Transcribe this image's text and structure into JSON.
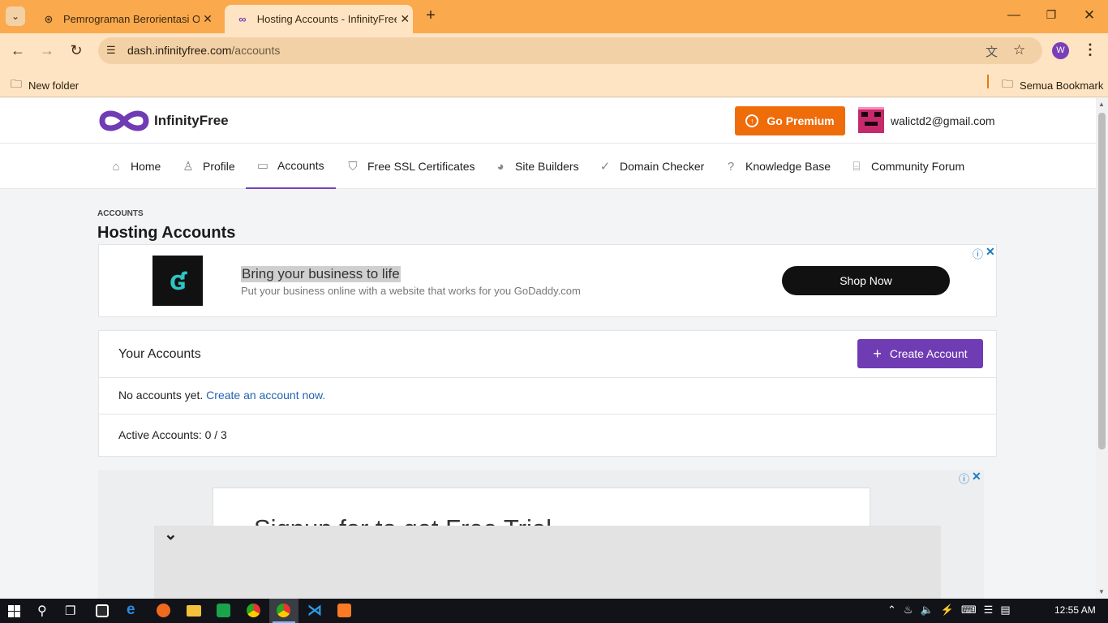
{
  "browser": {
    "tabs": [
      {
        "title": "Pemrograman Berorientasi Obj",
        "icon": "chatgpt-icon"
      },
      {
        "title": "Hosting Accounts - InfinityFree",
        "icon": "infinity-icon"
      }
    ],
    "url_domain": "dash.infinityfree.com",
    "url_path": "/accounts",
    "bookmarks": {
      "left": "New folder",
      "right": "Semua Bookmark"
    },
    "profile_initial": "W"
  },
  "header": {
    "logo_text": "InfinityFree",
    "premium_button": "Go Premium",
    "user_email": "walictd2@gmail.com"
  },
  "nav": [
    {
      "label": "Home",
      "icon": "home-icon"
    },
    {
      "label": "Profile",
      "icon": "user-icon"
    },
    {
      "label": "Accounts",
      "icon": "server-icon"
    },
    {
      "label": "Free SSL Certificates",
      "icon": "shield-icon"
    },
    {
      "label": "Site Builders",
      "icon": "palette-icon"
    },
    {
      "label": "Domain Checker",
      "icon": "check-circle-icon"
    },
    {
      "label": "Knowledge Base",
      "icon": "help-icon"
    },
    {
      "label": "Community Forum",
      "icon": "chat-icon"
    }
  ],
  "main": {
    "breadcrumb": "ACCOUNTS",
    "title": "Hosting Accounts",
    "ad1": {
      "headline": "Bring your business to life",
      "body": "Put your business online with a website that works for you GoDaddy.com",
      "cta": "Shop Now"
    },
    "accounts_card": {
      "title": "Your Accounts",
      "create_button": "Create Account",
      "empty_text": "No accounts yet.",
      "empty_link": "Create an account now.",
      "active_accounts": "Active Accounts: 0 / 3"
    },
    "ad2": {
      "headline": "Signup for to get Free Trial"
    }
  },
  "taskbar": {
    "time": "12:55 AM"
  },
  "colors": {
    "tab_bar": "#fba94d",
    "toolbar": "#ffe4c4",
    "premium": "#ef6c0a",
    "accent_purple": "#6f3cb4",
    "link_blue": "#2563b0"
  }
}
